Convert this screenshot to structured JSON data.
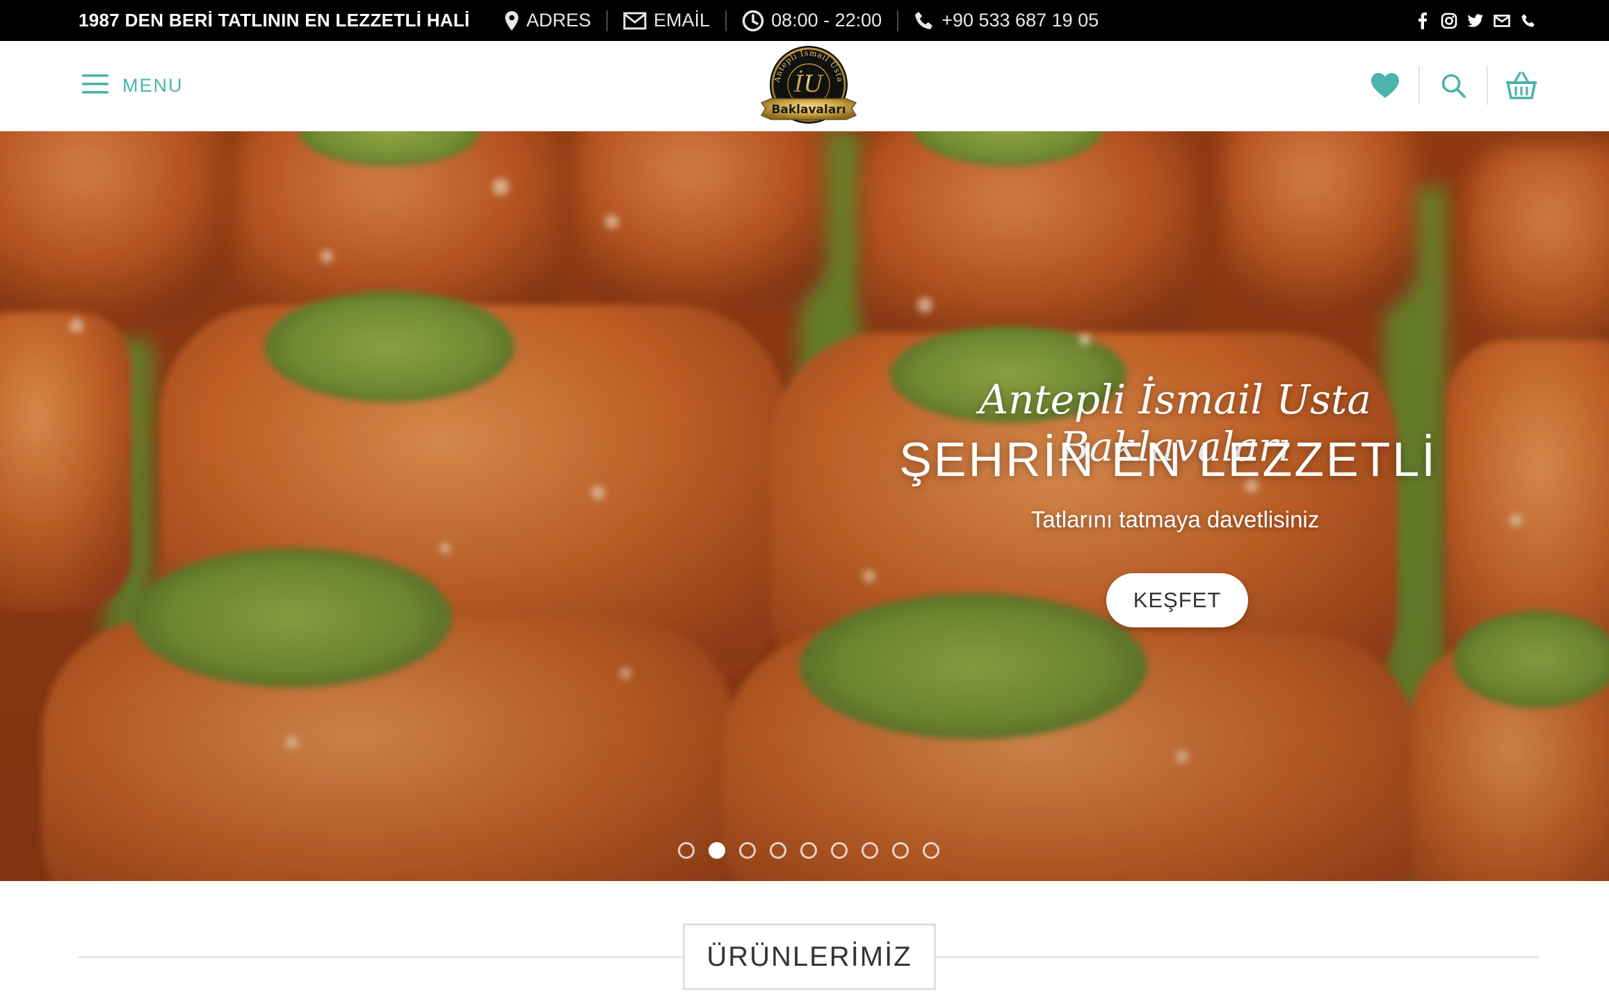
{
  "topbar": {
    "tagline": "1987 DEN BERİ TATLININ EN LEZZETLİ HALİ",
    "address_label": "ADRES",
    "email_label": "EMAİL",
    "hours": "08:00 - 22:00",
    "phone": "+90 533 687 19 05",
    "icons": {
      "address": "map-pin-icon",
      "email": "envelope-icon",
      "hours": "clock-icon",
      "phone": "phone-icon"
    },
    "socials": [
      "facebook-icon",
      "instagram-icon",
      "twitter-icon",
      "envelope-icon",
      "phone-icon"
    ]
  },
  "header": {
    "menu_label": "MENU",
    "logo": {
      "ring_text": "Antepli İsmail Usta",
      "monogram": "İU",
      "banner_text": "Baklavaları"
    },
    "icons": [
      "heart-icon",
      "search-icon",
      "basket-icon"
    ]
  },
  "hero": {
    "script_title": "Antepli İsmail Usta Baklavaları",
    "title": "ŞEHRİN EN LEZZETLİ",
    "subtitle": "Tatlarını tatmaya davetlisiniz",
    "button_label": "KEŞFET",
    "slide_count": 9,
    "active_slide": 2
  },
  "products": {
    "heading": "ÜRÜNLERİMİZ"
  },
  "colors": {
    "accent": "#4bb3ab",
    "topbar_bg": "#000000",
    "pastry": "#c8561c",
    "pistachio": "#7f9a37"
  }
}
